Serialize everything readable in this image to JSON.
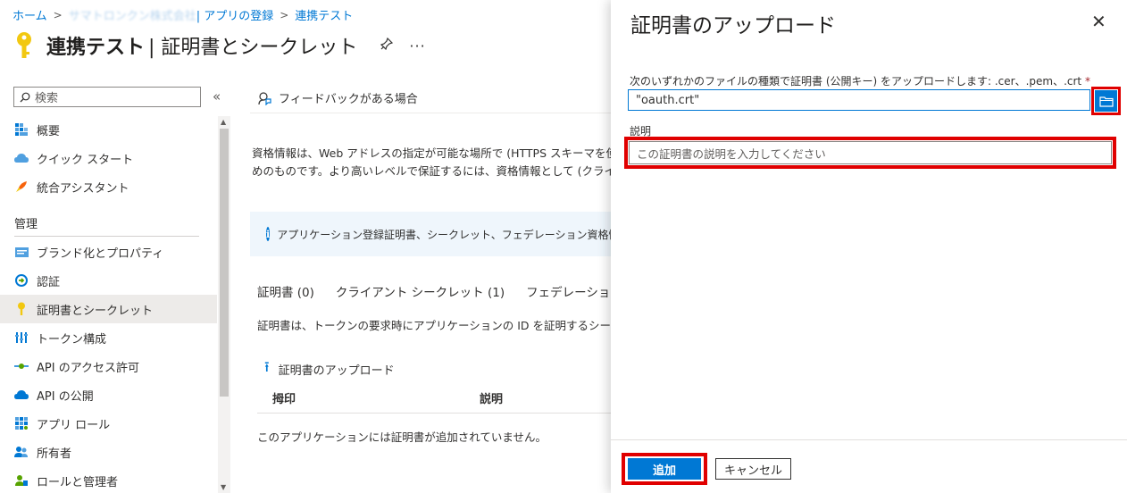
{
  "breadcrumb": {
    "home": "ホーム",
    "blurred_tenant": "サマトロンクン株式会社",
    "app_registration": "| アプリの登録",
    "current": "連携テスト"
  },
  "header": {
    "app_name": "連携テスト",
    "page_name": "| 証明書とシークレット",
    "pin_glyph": "✎",
    "more_glyph": "···"
  },
  "sidebar": {
    "search_placeholder": "検索",
    "collapse_glyph": "«",
    "items_top": [
      {
        "label": "概要",
        "icon": "overview-icon"
      },
      {
        "label": "クイック スタート",
        "icon": "quickstart-icon"
      },
      {
        "label": "統合アシスタント",
        "icon": "rocket-icon"
      }
    ],
    "section_manage": "管理",
    "items_manage": [
      {
        "label": "ブランド化とプロパティ",
        "icon": "branding-icon"
      },
      {
        "label": "認証",
        "icon": "auth-icon"
      },
      {
        "label": "証明書とシークレット",
        "icon": "key-icon",
        "active": true
      },
      {
        "label": "トークン構成",
        "icon": "token-icon"
      },
      {
        "label": "API のアクセス許可",
        "icon": "api-permission-icon"
      },
      {
        "label": "API の公開",
        "icon": "cloud-icon"
      },
      {
        "label": "アプリ ロール",
        "icon": "app-roles-icon"
      },
      {
        "label": "所有者",
        "icon": "owners-icon"
      },
      {
        "label": "ロールと管理者",
        "icon": "roles-admin-icon"
      }
    ]
  },
  "main": {
    "feedback": "フィードバックがある場合",
    "description_line1": "資格情報は、Web アドレスの指定が可能な場所で (HTTPS スキーマを使用して)",
    "description_line2": "めのものです。より高いレベルで保証するには、資格情報として (クライアント シーク",
    "info_text": "アプリケーション登録証明書、シークレット、フェデレーション資格情報は、下のタブ",
    "tabs": [
      "証明書 (0)",
      "クライアント シークレット (1)",
      "フェデレーション資格情報"
    ],
    "tab_description": "証明書は、トークンの要求時にアプリケーションの ID を証明するシークレットとして",
    "upload_label": "証明書のアップロード",
    "columns": [
      "拇印",
      "説明"
    ],
    "empty_message": "このアプリケーションには証明書が追加されていません。"
  },
  "panel": {
    "title": "証明書のアップロード",
    "close_glyph": "✕",
    "file_label": "次のいずれかのファイルの種類で証明書 (公開キー) をアップロードします: .cer、.pem、.crt",
    "required_mark": "*",
    "file_value": "\"oauth.crt\"",
    "description_label": "説明",
    "description_placeholder": "この証明書の説明を入力してください",
    "add_button": "追加",
    "cancel_button": "キャンセル"
  },
  "colors": {
    "accent": "#0078d4",
    "highlight": "#e00000",
    "key_yellow": "#f2c811"
  }
}
